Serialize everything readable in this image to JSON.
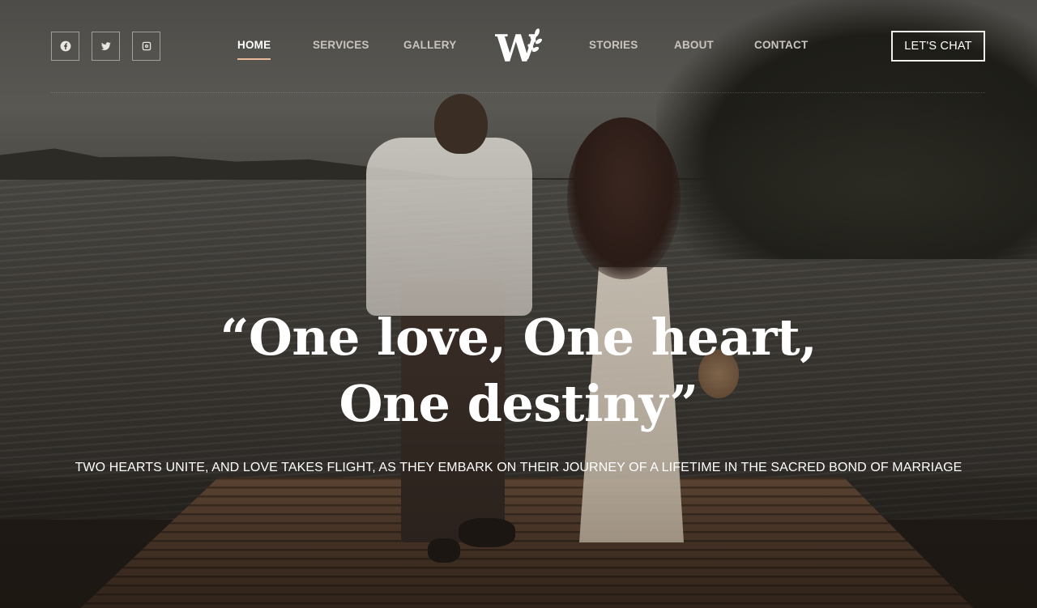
{
  "social": {
    "items": [
      {
        "icon": "facebook-icon"
      },
      {
        "icon": "twitter-icon"
      },
      {
        "icon": "instagram-icon"
      }
    ]
  },
  "nav": {
    "home": "HOME",
    "services": "SERVICES",
    "gallery": "GALLERY",
    "stories": "STORIES",
    "about": "ABOUT",
    "contact": "CONTACT",
    "active": "HOME"
  },
  "logo": {
    "letter": "W",
    "icon": "leaf-sprig-icon"
  },
  "cta": {
    "label": "LET'S CHAT"
  },
  "hero": {
    "headline_line1": "“One love, One heart,",
    "headline_line2": "One destiny”",
    "subtitle": "TWO HEARTS UNITE, AND LOVE TAKES FLIGHT, AS THEY EMBARK ON THEIR JOURNEY OF A LIFETIME IN THE SACRED BOND OF MARRIAGE"
  },
  "colors": {
    "accent_underline": "#e9b99a",
    "text": "#ffffff",
    "nav_inactive": "#c9c4bd"
  }
}
